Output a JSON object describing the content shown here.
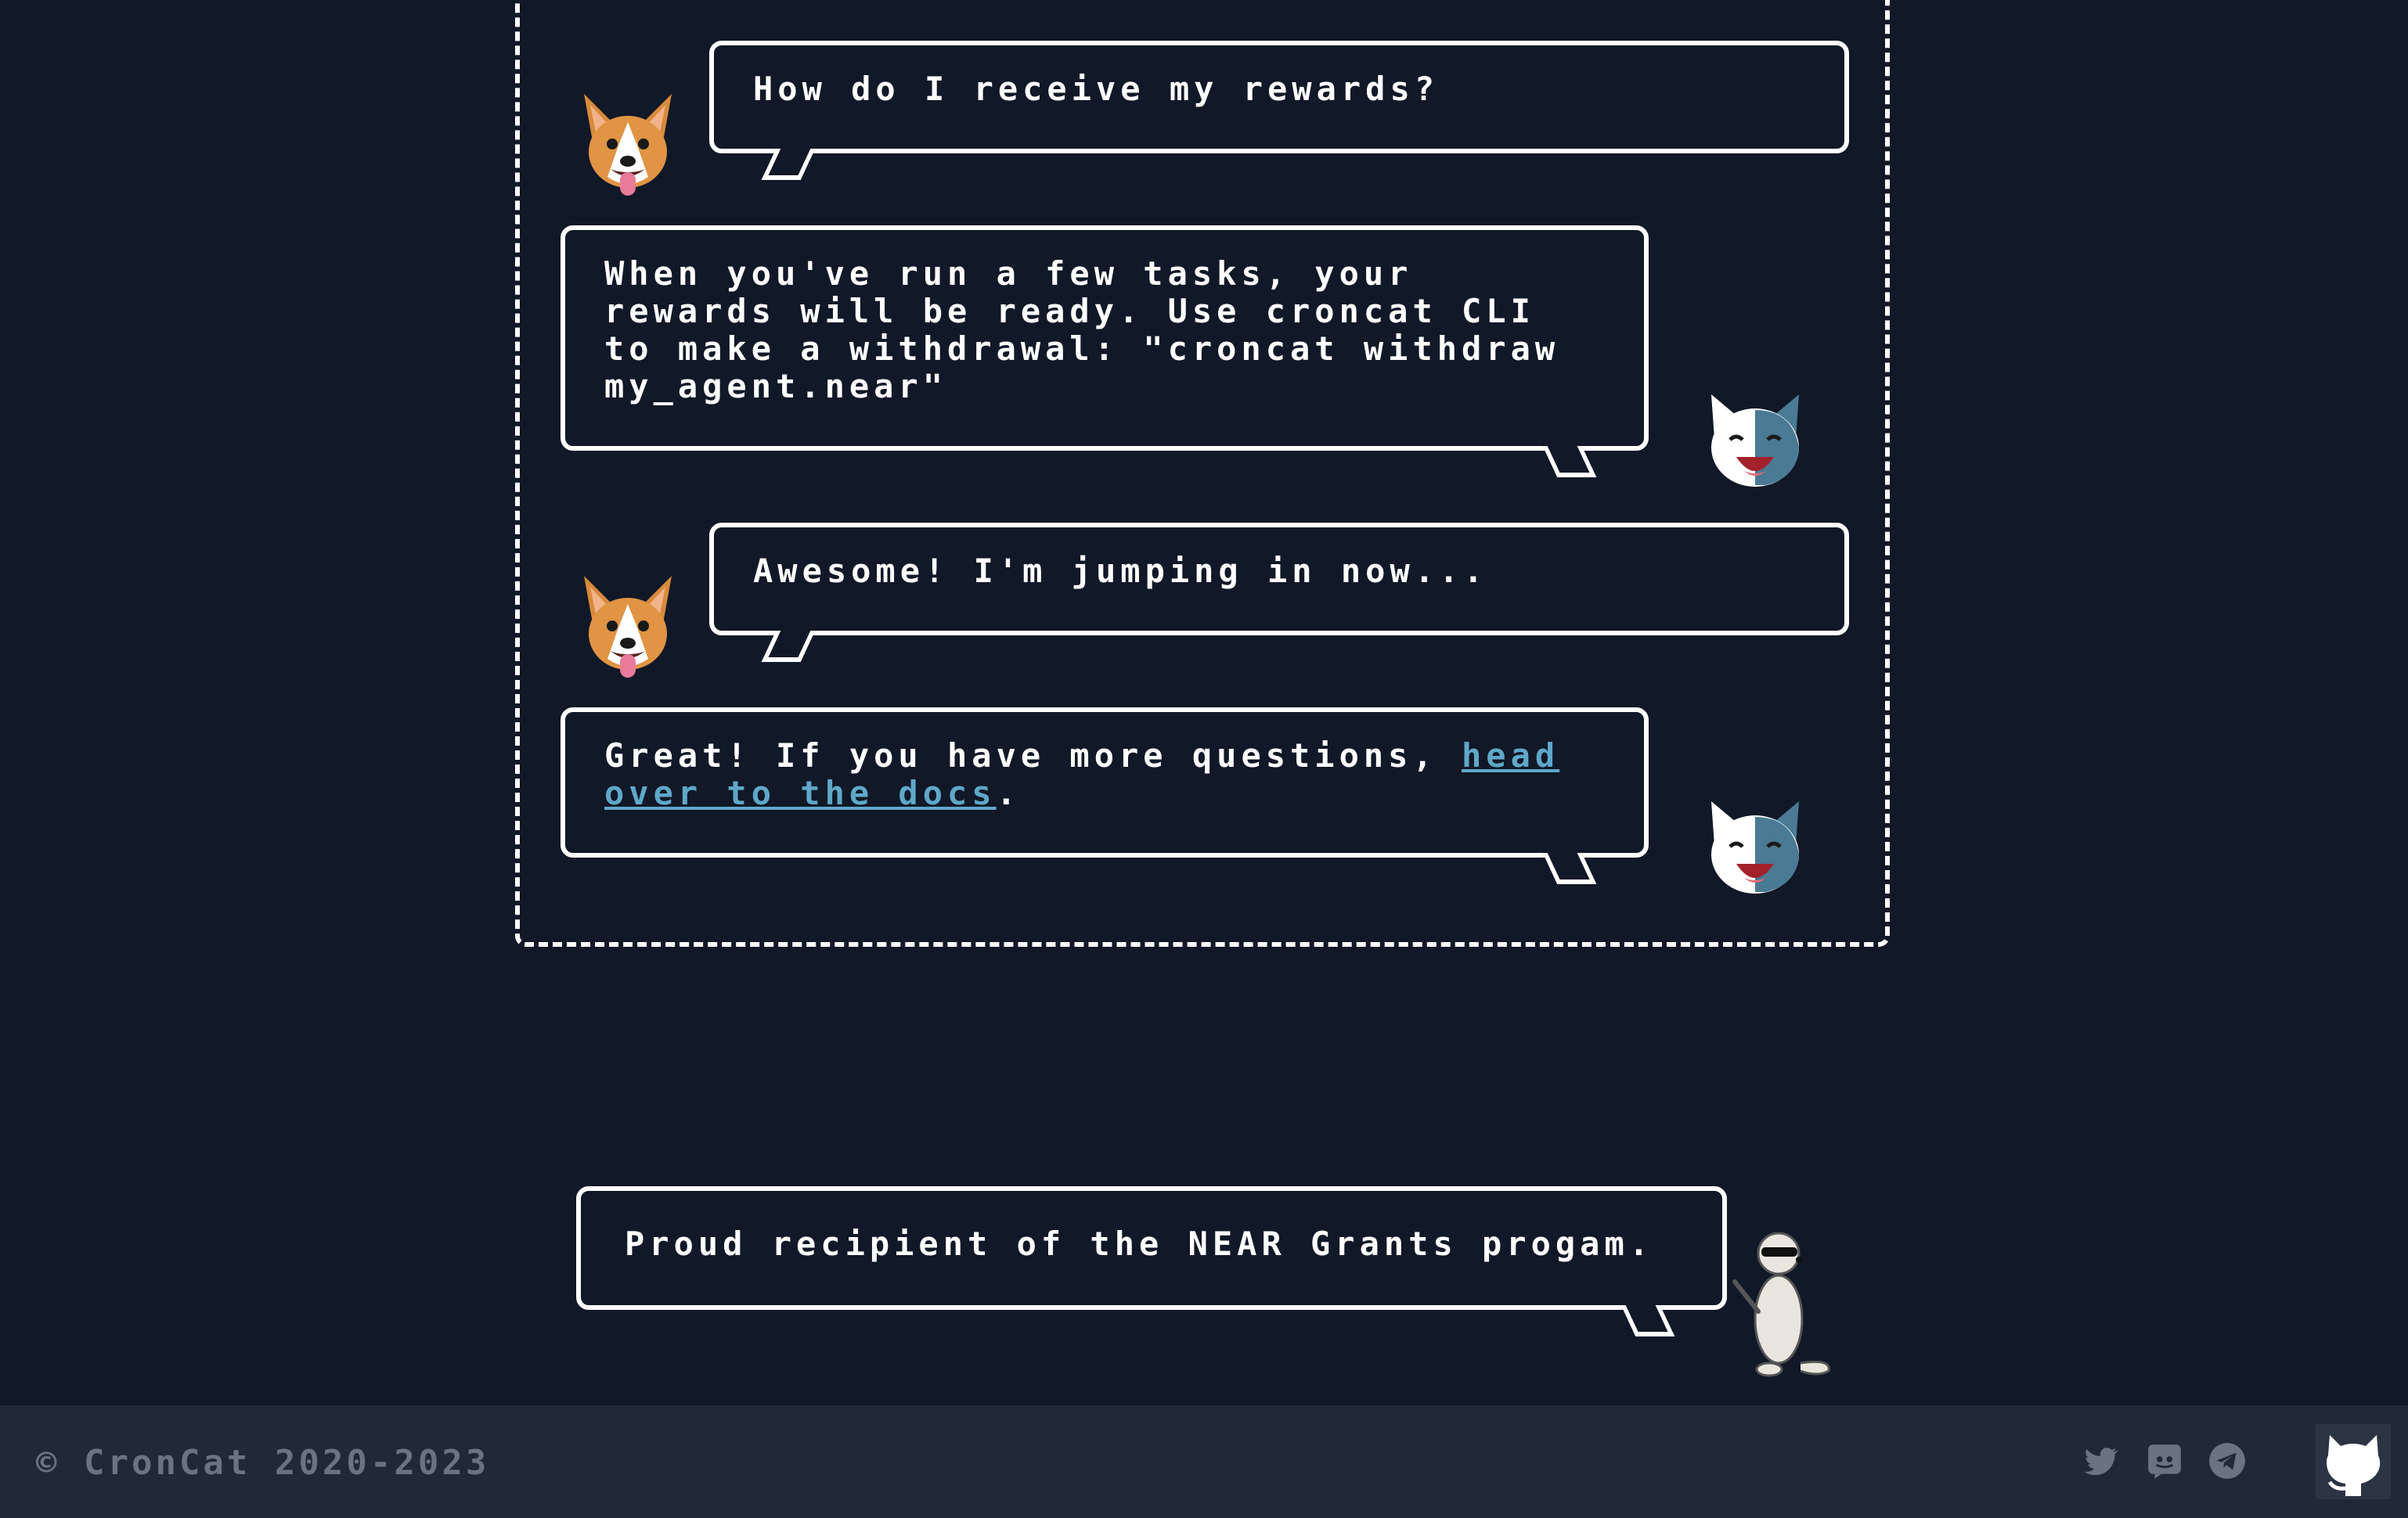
{
  "conversation": [
    {
      "speaker": "dog",
      "text": "How do I receive my rewards?"
    },
    {
      "speaker": "cat",
      "text": "When you've run a few tasks, your rewards will be ready. Use croncat CLI to make a withdrawal: \"croncat withdraw my_agent.near\""
    },
    {
      "speaker": "dog",
      "text": "Awesome! I'm jumping in now..."
    },
    {
      "speaker": "cat",
      "text_before": "Great! If you have more questions, ",
      "link_text": "head over to the docs",
      "text_after": "."
    }
  ],
  "grant": {
    "text": "Proud recipient of the NEAR Grants progam."
  },
  "footer": {
    "copyright": "© CronCat 2020-2023",
    "social_icons": [
      "twitter-icon",
      "discord-icon",
      "telegram-icon",
      "github-icon"
    ]
  },
  "colors": {
    "background": "#111827",
    "footer": "#1f2937",
    "link": "#5fa8c9",
    "muted": "#6b7280"
  }
}
